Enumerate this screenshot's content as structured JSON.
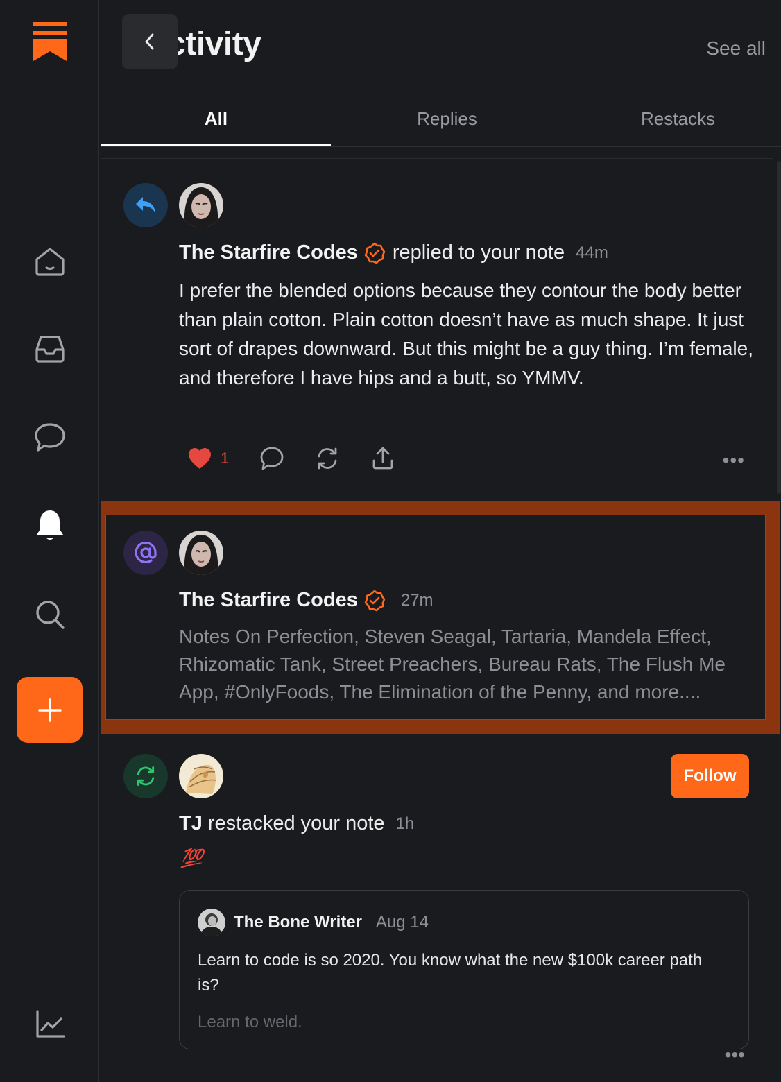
{
  "header": {
    "title": "Activity",
    "see_all": "See all"
  },
  "tabs": [
    {
      "label": "All"
    },
    {
      "label": "Replies"
    },
    {
      "label": "Restacks"
    }
  ],
  "colors": {
    "accent": "#ff6719",
    "reply_badge": "#1a3550",
    "mention_badge": "#2c2546",
    "restack_badge": "#17382a",
    "like": "#e5483f"
  },
  "sidebar": {
    "icons": [
      "substack-logo-icon",
      "home-icon",
      "inbox-icon",
      "chat-icon",
      "bell-icon",
      "search-icon",
      "plus-icon",
      "stats-icon"
    ]
  },
  "items": [
    {
      "type_icon": "reply-arrow-icon",
      "author": "The Starfire Codes",
      "action": "replied to your note",
      "time": "44m",
      "body": "I prefer the blended options because they contour the body better than plain cotton. Plain cotton doesn’t have as much shape. It just sort of drapes downward. But this might be a guy thing. I’m female, and therefore I have hips and a butt, so YMMV.",
      "likes": "1",
      "more": "•••"
    },
    {
      "type_icon": "at-sign-icon",
      "author": "The Starfire Codes",
      "time": "27m",
      "body": "Notes On Perfection, Steven Seagal, Tartaria, Mandela Effect, Rhizomatic Tank, Street Preachers, Bureau Rats, The Flush Me App, #OnlyFoods, The Elimination of the Penny, and more...."
    },
    {
      "type_icon": "restack-icon",
      "author": "TJ",
      "action": "restacked your note",
      "time": "1h",
      "follow_label": "Follow",
      "emoji": "💯",
      "quote": {
        "author": "The Bone Writer",
        "date": "Aug 14",
        "text": "Learn to code is so 2020. You know what the new $100k career path is?",
        "sub": "Learn to weld."
      },
      "more": "•••"
    }
  ]
}
